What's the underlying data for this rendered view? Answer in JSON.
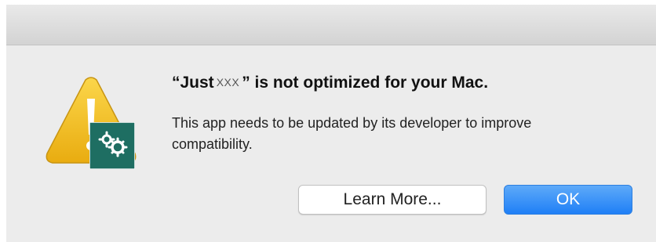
{
  "dialog": {
    "title_prefix": "“Just",
    "title_redacted": "XXX",
    "title_suffix": "” is not optimized for your Mac.",
    "message": "This app needs to be updated by its developer to improve compatibility."
  },
  "buttons": {
    "learn_more_label": "Learn More...",
    "ok_label": "OK"
  },
  "icons": {
    "warning": "warning-triangle-icon",
    "app_badge": "gears-icon"
  },
  "colors": {
    "warning_yellow": "#f2c31c",
    "app_badge_teal": "#1e6e62",
    "primary_blue": "#1f7ff6"
  }
}
